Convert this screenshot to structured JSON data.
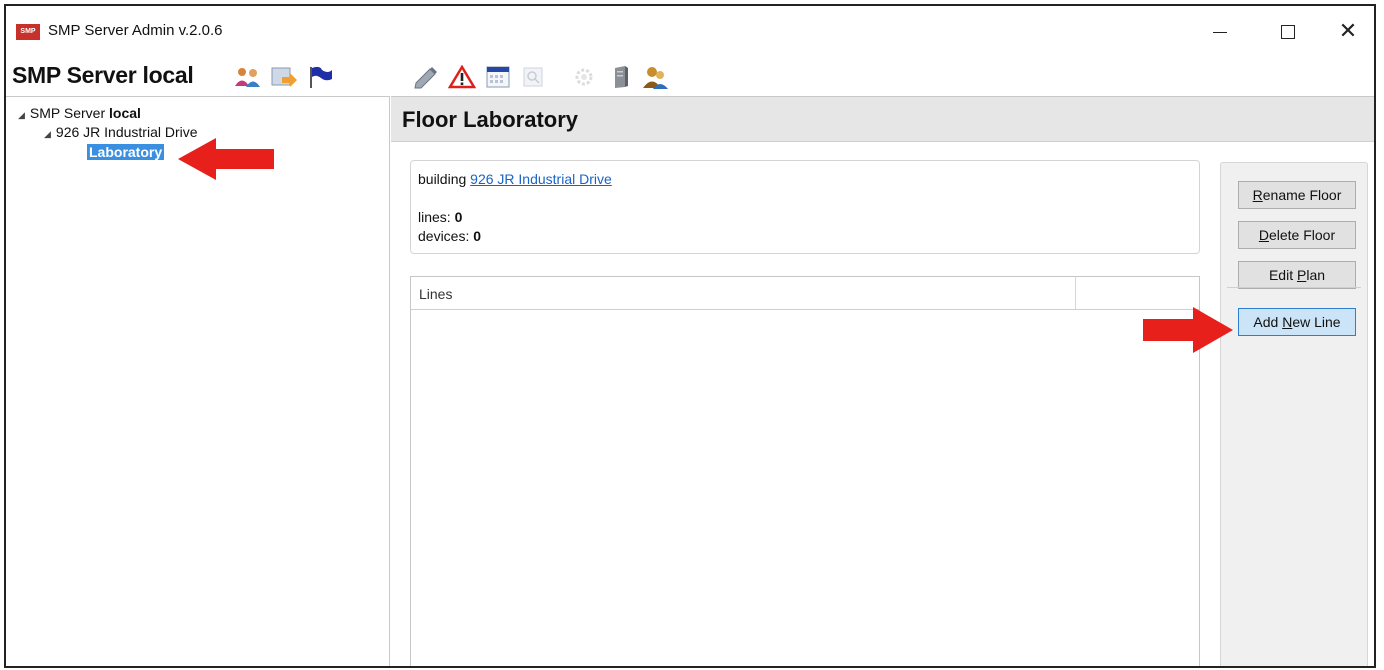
{
  "window": {
    "title": "SMP Server Admin v.2.0.6",
    "logo_text": "SMP",
    "minimize_label": "",
    "maximize_label": "",
    "close_label": "✕"
  },
  "toolbar": {
    "server_title": "SMP Server local",
    "icons": [
      "users-icon",
      "export-icon",
      "flag-icon",
      "pencil-icon",
      "warning-icon",
      "calendar-icon",
      "search-icon",
      "gear-icon",
      "server-icon",
      "user-group-icon"
    ]
  },
  "tree": {
    "root_prefix": "SMP Server ",
    "root_bold": "local",
    "building": "926 JR Industrial Drive",
    "floor": "Laboratory"
  },
  "floor_view": {
    "title": "Floor Laboratory",
    "building_label": "building ",
    "building_link": "926 JR Industrial Drive",
    "lines_label": "lines: ",
    "lines_count": "0",
    "devices_label": "devices: ",
    "devices_count": "0",
    "grid_column": "Lines"
  },
  "buttons": {
    "rename_first": "R",
    "rename_rest": "ename Floor",
    "delete_first": "D",
    "delete_rest": "elete Floor",
    "edit_pre": "Edit ",
    "edit_u": "P",
    "edit_post": "lan",
    "add_pre": "Add ",
    "add_u": "N",
    "add_post": "ew Line"
  },
  "colors": {
    "selection": "#3b8fe0",
    "link": "#1a64c8",
    "annotation_arrow": "#e8201c",
    "active_button": "#cce4f7"
  }
}
